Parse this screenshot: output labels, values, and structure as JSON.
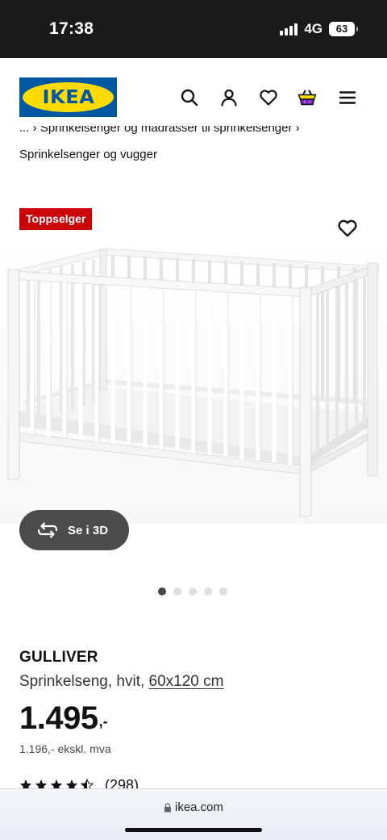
{
  "status_bar": {
    "time": "17:38",
    "network": "4G",
    "battery": "63"
  },
  "header": {
    "logo_text": "IKEA",
    "icons": [
      "search-icon",
      "user-icon",
      "heart-icon",
      "shopping-bag-icon",
      "menu-icon"
    ]
  },
  "breadcrumb": {
    "partial": "... › Sprinkelsenger og madrasser til sprinkelsenger ›",
    "current": "Sprinkelsenger og vugger"
  },
  "product": {
    "badge": "Toppselger",
    "view_3d_label": "Se i 3D",
    "image_count": 5,
    "active_image": 1,
    "name": "GULLIVER",
    "description": "Sprinkelseng, hvit,",
    "size": "60x120 cm",
    "price_integer": "1.495",
    "price_decimal": ",-",
    "price_ex_vat": "1.196,- ekskl. mva",
    "rating": 4.5,
    "review_count": "(298)"
  },
  "browser": {
    "url": "ikea.com"
  },
  "colors": {
    "ikea_blue": "#0058a3",
    "ikea_yellow": "#ffdb00",
    "badge_red": "#cc0008",
    "button_dark": "#4b4b4b"
  }
}
